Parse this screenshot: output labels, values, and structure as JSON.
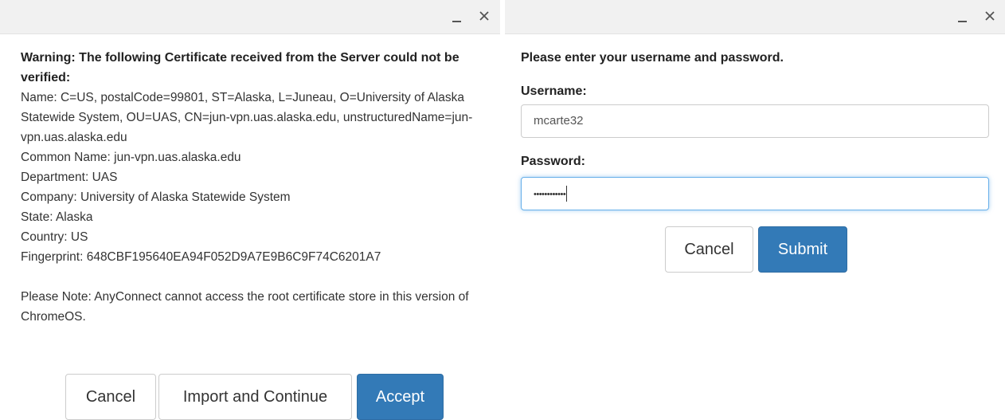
{
  "cert_dialog": {
    "warning": "Warning: The following Certificate received from the Server could not be verified:",
    "lines": [
      "Name: C=US, postalCode=99801, ST=Alaska, L=Juneau, O=University of Alaska Statewide System, OU=UAS, CN=jun-vpn.uas.alaska.edu, unstructuredName=jun-vpn.uas.alaska.edu",
      "Common Name: jun-vpn.uas.alaska.edu",
      "Department: UAS",
      "Company: University of Alaska Statewide System",
      "State: Alaska",
      "Country: US",
      "Fingerprint: 648CBF195640EA94F052D9A7E9B6C9F74C6201A7"
    ],
    "note": "Please Note: AnyConnect cannot access the root certificate store in this version of ChromeOS.",
    "buttons": {
      "cancel": "Cancel",
      "import": "Import and Continue",
      "accept": "Accept"
    }
  },
  "login_dialog": {
    "prompt": "Please enter your username and password.",
    "username_label": "Username:",
    "username_value": "mcarte32",
    "password_label": "Password:",
    "password_mask": "••••••••••••",
    "buttons": {
      "cancel": "Cancel",
      "submit": "Submit"
    }
  },
  "window_controls": {
    "minimize_icon": "minimize-icon",
    "close_icon": "close-icon"
  },
  "colors": {
    "primary": "#337ab7",
    "titlebar": "#f1f1f1",
    "focus_border": "#66afe9"
  }
}
